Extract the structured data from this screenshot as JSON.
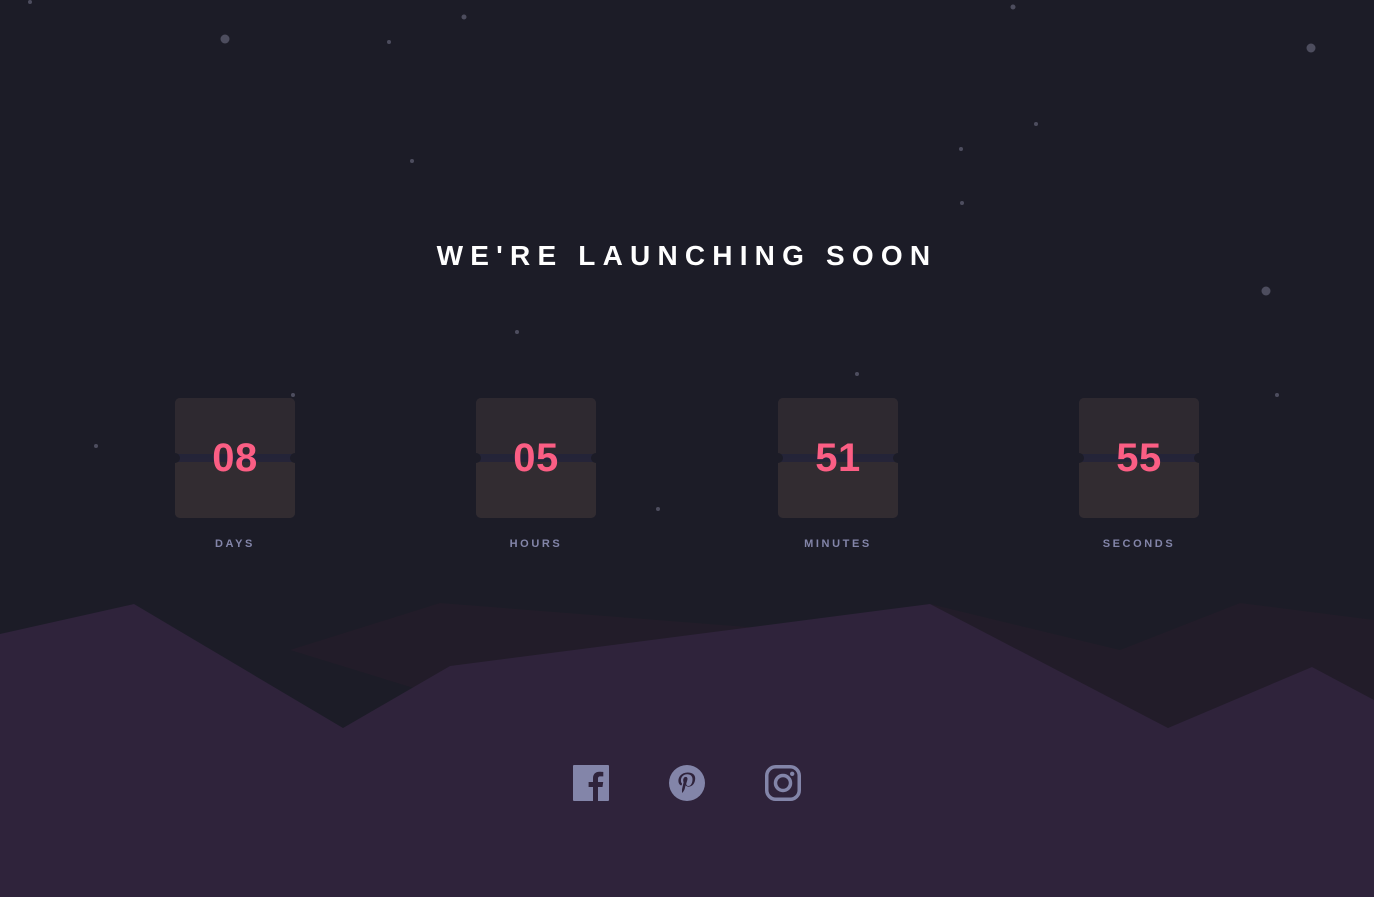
{
  "title": "WE'RE LAUNCHING SOON",
  "colors": {
    "background": "#1c1c27",
    "hills": "#2f233b",
    "accent": "#fb5e84",
    "label": "#8385a9",
    "icon": "#8385a9"
  },
  "countdown": [
    {
      "value": "08",
      "label": "DAYS"
    },
    {
      "value": "05",
      "label": "HOURS"
    },
    {
      "value": "51",
      "label": "MINUTES"
    },
    {
      "value": "55",
      "label": "SECONDS"
    }
  ],
  "social": [
    {
      "name": "facebook-icon"
    },
    {
      "name": "pinterest-icon"
    },
    {
      "name": "instagram-icon"
    }
  ]
}
